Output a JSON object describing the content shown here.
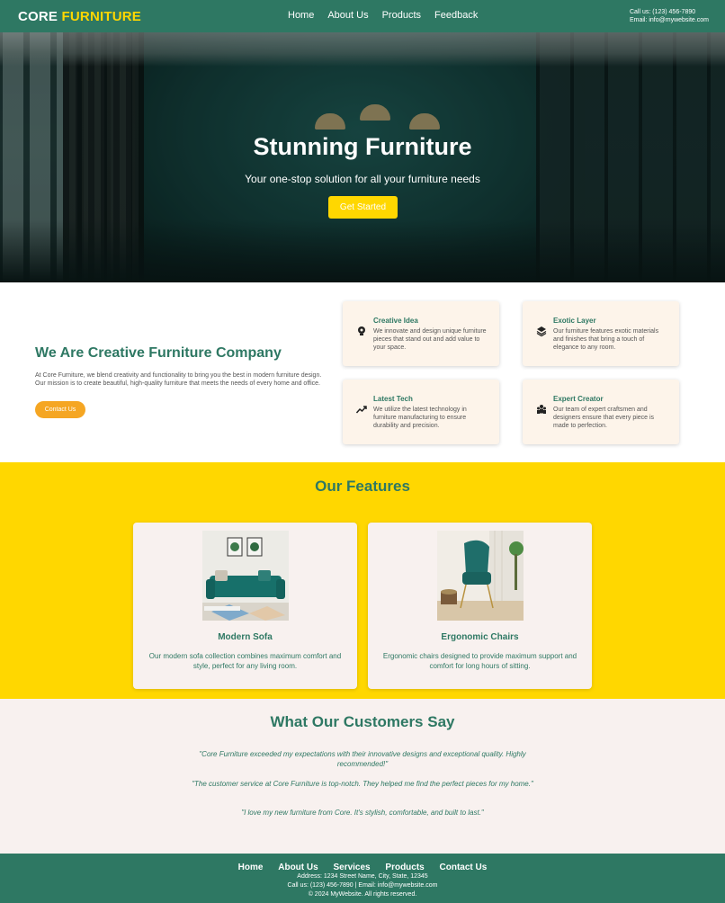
{
  "header": {
    "brand_part1": "CORE",
    "brand_part2": "FURNITURE",
    "nav": [
      "Home",
      "About Us",
      "Products",
      "Feedback"
    ],
    "phone": "Call us: (123) 456-7890",
    "email": "Email: info@mywebsite.com"
  },
  "hero": {
    "title": "Stunning Furniture",
    "subtitle": "Your one-stop solution for all your furniture needs",
    "cta": "Get Started"
  },
  "about": {
    "title": "We Are Creative Furniture Company",
    "text": "At Core Furniture, we blend creativity and functionality to bring you the best in modern furniture design. Our mission is to create beautiful, high-quality furniture that meets the needs of every home and office.",
    "button": "Contact Us",
    "cards": [
      {
        "title": "Creative Idea",
        "text": "We innovate and design unique furniture pieces that stand out and add value to your space.",
        "icon": "lightbulb-icon"
      },
      {
        "title": "Exotic Layer",
        "text": "Our furniture features exotic materials and finishes that bring a touch of elegance to any room.",
        "icon": "layers-icon"
      },
      {
        "title": "Latest Tech",
        "text": "We utilize the latest technology in furniture manufacturing to ensure durability and precision.",
        "icon": "trend-icon"
      },
      {
        "title": "Expert Creator",
        "text": "Our team of expert craftsmen and designers ensure that every piece is made to perfection.",
        "icon": "team-icon"
      }
    ]
  },
  "features": {
    "title": "Our Features",
    "items": [
      {
        "title": "Modern Sofa",
        "text": "Our modern sofa collection combines maximum comfort and style, perfect for any living room."
      },
      {
        "title": "Ergonomic Chairs",
        "text": "Ergonomic chairs designed to provide maximum support and comfort for long hours of sitting."
      }
    ]
  },
  "testimonials": {
    "title": "What Our Customers Say",
    "quotes": [
      "\"Core Furniture exceeded my expectations with their innovative designs and exceptional quality. Highly recommended!\"",
      "\"The customer service at Core Furniture is top-notch. They helped me find the perfect pieces for my home.\"",
      "\"I love my new furniture from Core. It's stylish, comfortable, and built to last.\""
    ]
  },
  "footer": {
    "nav": [
      "Home",
      "About Us",
      "Services",
      "Products",
      "Contact Us"
    ],
    "address": "Address: 1234 Street Name, City, State, 12345",
    "contact": "Call us: (123) 456-7890 | Email: info@mywebsite.com",
    "copyright": "© 2024 MyWebsite. All rights reserved."
  },
  "colors": {
    "primary": "#2e7863",
    "accent": "#ffd700",
    "button_orange": "#f5a623",
    "card_bg": "#fdf4ea",
    "section_bg": "#f8f1ef"
  }
}
